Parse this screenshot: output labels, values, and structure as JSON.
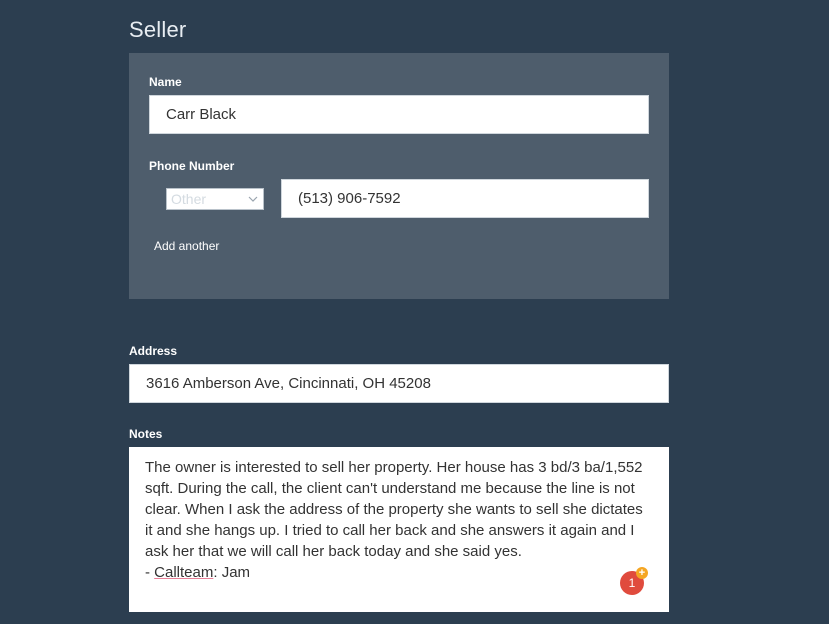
{
  "seller": {
    "title": "Seller",
    "name_label": "Name",
    "name_value": "Carr Black",
    "phone_label": "Phone Number",
    "phone_type": "Other",
    "phone_value": "(513) 906-7592",
    "add_another": "Add another"
  },
  "address": {
    "label": "Address",
    "value": "3616 Amberson Ave, Cincinnati, OH 45208"
  },
  "notes": {
    "label": "Notes",
    "body": "The owner is interested to sell her property. Her house has 3 bd/3 ba/1,552 sqft. During the call, the client can't understand me because the line is not clear. When I ask the address of the property she wants to sell she dictates it and she hangs up. I tried to call her back and she answers it again and I ask her that we will call her back today and she said yes.",
    "signature_prefix": "- ",
    "signature_word": "Callteam",
    "signature_suffix": ": Jam"
  },
  "badge": {
    "count": "1",
    "plus": "+",
    "colors": {
      "badge": "#e04b3d",
      "plus": "#f5a623"
    }
  },
  "colors": {
    "background": "#2c3e50",
    "card": "#4e5d6c"
  }
}
